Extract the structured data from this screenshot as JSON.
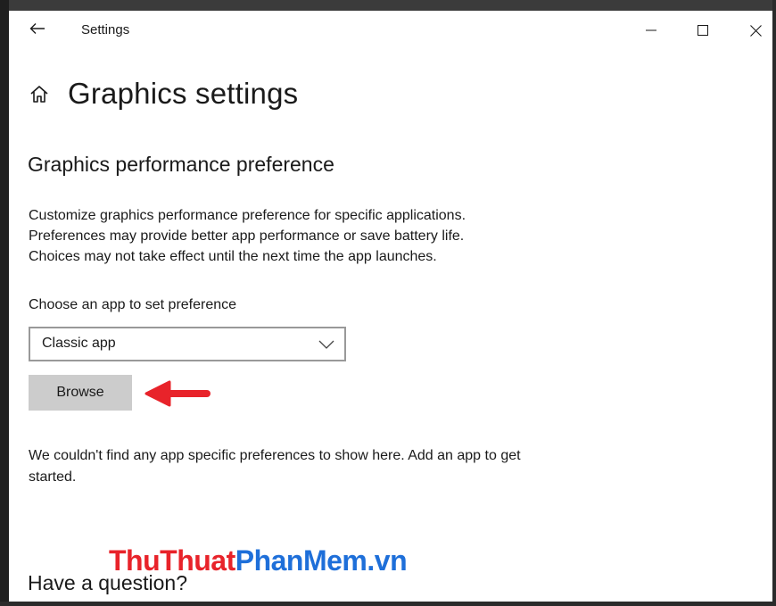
{
  "window": {
    "title": "Settings",
    "controls": {
      "minimize": "minimize-icon",
      "maximize": "maximize-icon",
      "close": "close-icon"
    }
  },
  "page": {
    "title": "Graphics settings",
    "home_icon": "home-icon"
  },
  "section": {
    "title": "Graphics performance preference",
    "description": [
      "Customize graphics performance preference for specific applications.",
      "Preferences may provide better app performance or save battery life.",
      "Choices may not take effect until the next time the app launches."
    ],
    "choose_label": "Choose an app to set preference",
    "dropdown": {
      "selected": "Classic app",
      "icon": "chevron-down-icon"
    },
    "browse_label": "Browse",
    "empty_message": "We couldn't find any app specific preferences to show here. Add an app to get started."
  },
  "help": {
    "title": "Have a question?"
  },
  "watermark": {
    "part1": "ThuThuat",
    "part2": "PhanMem",
    "part3": ".vn"
  },
  "colors": {
    "annotation_arrow": "#e8232a",
    "watermark_red": "#e8232a",
    "watermark_blue": "#1e6fd9",
    "button_bg": "#cccccc"
  }
}
